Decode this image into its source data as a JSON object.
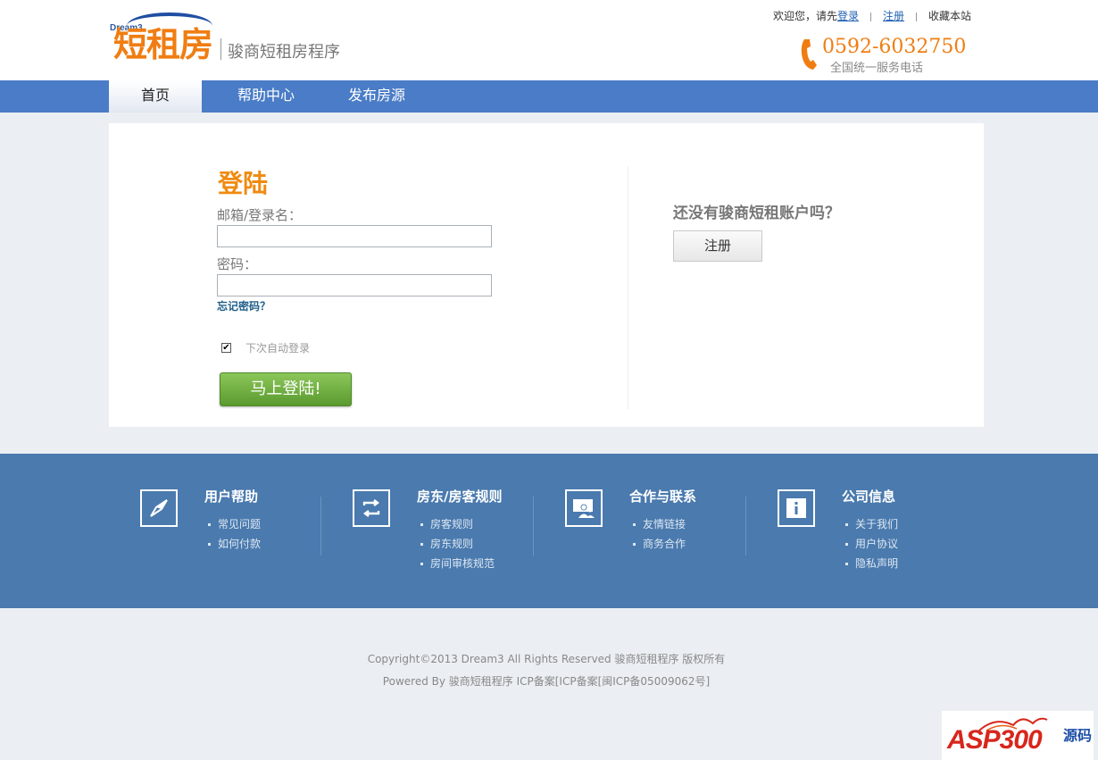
{
  "header": {
    "logo_brand": "Dream3",
    "logo_text": "短租房",
    "logo_subtitle": "骏商短租房程序",
    "welcome": "欢迎您，请先",
    "login_link": "登录",
    "register_link": "注册",
    "bookmark": "收藏本站",
    "phone_number": "0592-6032750",
    "phone_desc": "全国统一服务电话"
  },
  "nav": {
    "items": [
      {
        "label": "首页",
        "active": true
      },
      {
        "label": "帮助中心",
        "active": false
      },
      {
        "label": "发布房源",
        "active": false
      }
    ]
  },
  "login": {
    "title": "登陆",
    "email_label": "邮箱/登录名：",
    "email_value": "",
    "password_label": "密码：",
    "password_value": "",
    "forgot": "忘记密码？",
    "remember_checked": true,
    "remember_label": "下次自动登录",
    "submit": "马上登陆!"
  },
  "register": {
    "prompt": "还没有骏商短租账户吗？",
    "button": "注册"
  },
  "footer": {
    "columns": [
      {
        "icon": "compass-icon",
        "title": "用户帮助",
        "links": [
          "常见问题",
          "如何付款"
        ]
      },
      {
        "icon": "exchange-icon",
        "title": "房东/房客规则",
        "links": [
          "房客规则",
          "房东规则",
          "房间审核规范"
        ]
      },
      {
        "icon": "users-icon",
        "title": "合作与联系",
        "links": [
          "友情链接",
          "商务合作"
        ]
      },
      {
        "icon": "info-icon",
        "title": "公司信息",
        "links": [
          "关于我们",
          "用户协议",
          "隐私声明"
        ]
      }
    ],
    "copyright": "Copyright©2013 Dream3 All Rights Reserved 骏商短租程序  版权所有",
    "powered": "Powered By 骏商短租程序  ICP备案[ICP备案[闽ICP备05009062号]"
  },
  "watermark": {
    "brand": "ASP300",
    "suffix": "源码"
  },
  "colors": {
    "accent_orange": "#f07d12",
    "nav_blue": "#4a7cc7",
    "footer_blue": "#4a7aae",
    "login_green": "#6aaa3c"
  }
}
